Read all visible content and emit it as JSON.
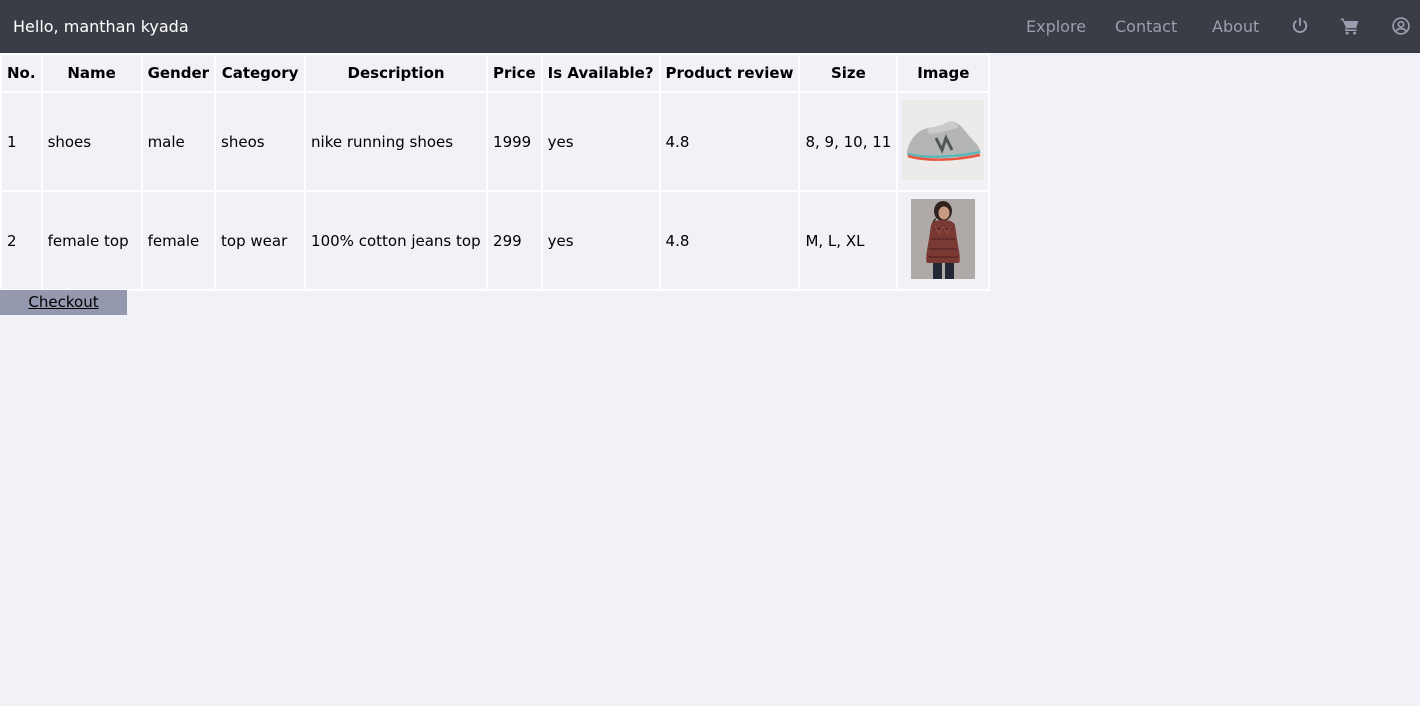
{
  "navbar": {
    "greeting": "Hello, manthan kyada",
    "links": [
      "Explore",
      "Contact",
      "About"
    ],
    "icons": [
      "power-icon",
      "cart-icon",
      "user-circle-icon"
    ],
    "background_color": "#3a3d45",
    "link_color": "#9a9eae"
  },
  "table": {
    "headers": [
      "No.",
      "Name",
      "Gender",
      "Category",
      "Description",
      "Price",
      "Is Available?",
      "Product review",
      "Size",
      "Image"
    ],
    "rows": [
      {
        "no": "1",
        "name": "shoes",
        "gender": "male",
        "category": "sheos",
        "description": "nike running shoes",
        "price": "1999",
        "available": "yes",
        "review": "4.8",
        "size": "8, 9, 10, 11",
        "image": "shoe-image"
      },
      {
        "no": "2",
        "name": "female top",
        "gender": "female",
        "category": "top wear",
        "description": "100% cotton jeans top",
        "price": "299",
        "available": "yes",
        "review": "4.8",
        "size": "M, L, XL",
        "image": "female-top-image"
      }
    ]
  },
  "checkout": {
    "label": "Checkout",
    "background_color": "#9599b0"
  }
}
